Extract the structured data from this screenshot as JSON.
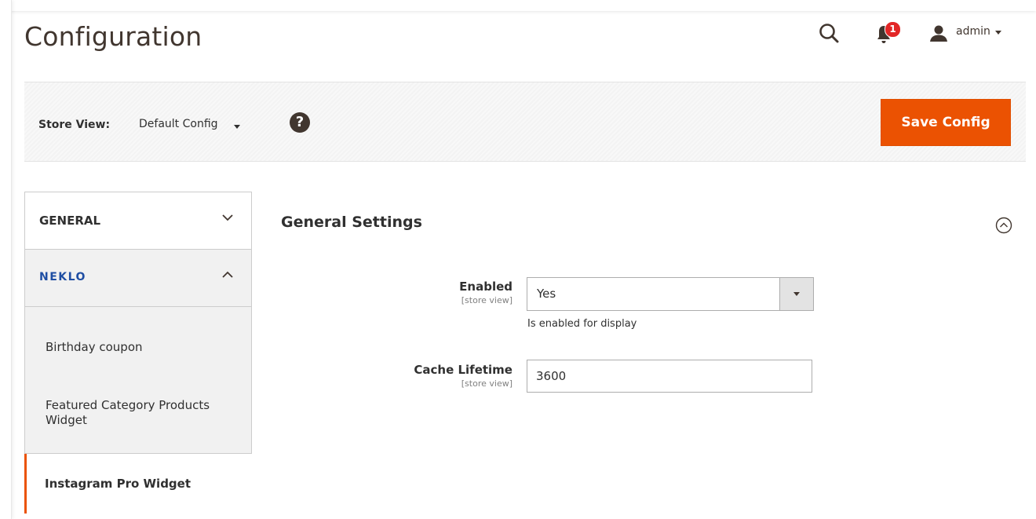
{
  "header": {
    "title": "Configuration",
    "notifications_count": "1",
    "user_name": "admin"
  },
  "store_bar": {
    "label": "Store View:",
    "selected_scope": "Default Config",
    "help": "?",
    "save_label": "Save Config"
  },
  "sidebar": {
    "tabs": [
      {
        "label": "GENERAL",
        "state": "collapsed"
      },
      {
        "label": "NEKLO",
        "state": "expanded"
      }
    ],
    "items": [
      {
        "label": "Birthday coupon",
        "active": false
      },
      {
        "label": "Featured Category Products Widget",
        "active": false
      },
      {
        "label": "Instagram Pro Widget",
        "active": true
      }
    ]
  },
  "section": {
    "title": "General Settings",
    "fields": [
      {
        "label": "Enabled",
        "scope": "[store view]",
        "value": "Yes",
        "note": "Is enabled for display"
      },
      {
        "label": "Cache Lifetime",
        "scope": "[store view]",
        "value": "3600"
      }
    ]
  },
  "colors": {
    "accent": "#eb5202",
    "brand": "#1f4ea3",
    "badge": "#e22626"
  }
}
